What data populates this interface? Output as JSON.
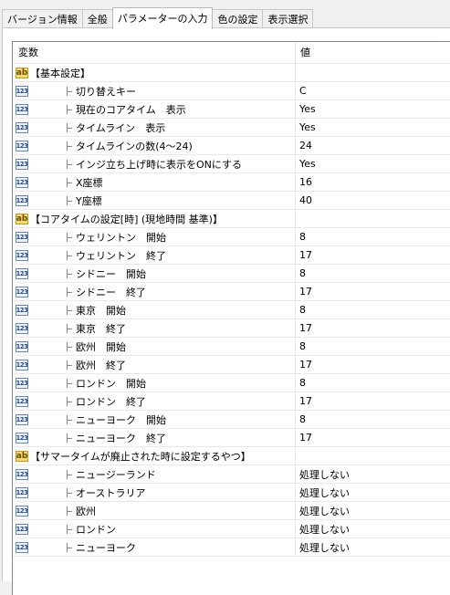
{
  "tabs": [
    "バージョン情報",
    "全般",
    "パラメーターの入力",
    "色の設定",
    "表示選択"
  ],
  "active_tab": 2,
  "columns": {
    "name": "変数",
    "value": "値"
  },
  "rows": [
    {
      "type": "group",
      "label": "【基本設定】",
      "value": ""
    },
    {
      "type": "item",
      "label": "切り替えキー",
      "value": "C"
    },
    {
      "type": "item",
      "label": "現在のコアタイム　表示",
      "value": "Yes"
    },
    {
      "type": "item",
      "label": "タイムライン　表示",
      "value": "Yes"
    },
    {
      "type": "item",
      "label": "タイムラインの数(4〜24)",
      "value": "24"
    },
    {
      "type": "item",
      "label": "インジ立ち上げ時に表示をONにする",
      "value": "Yes"
    },
    {
      "type": "item",
      "label": "X座標",
      "value": "16"
    },
    {
      "type": "item",
      "label": "Y座標",
      "value": "40"
    },
    {
      "type": "group",
      "label": "【コアタイムの設定[時] (現地時間 基準)】",
      "value": ""
    },
    {
      "type": "item",
      "label": "ウェリントン　開始",
      "value": "8"
    },
    {
      "type": "item",
      "label": "ウェリントン　終了",
      "value": "17"
    },
    {
      "type": "item",
      "label": "シドニー　開始",
      "value": "8"
    },
    {
      "type": "item",
      "label": "シドニー　終了",
      "value": "17"
    },
    {
      "type": "item",
      "label": "東京　開始",
      "value": "8"
    },
    {
      "type": "item",
      "label": "東京　終了",
      "value": "17"
    },
    {
      "type": "item",
      "label": "欧州　開始",
      "value": "8"
    },
    {
      "type": "item",
      "label": "欧州　終了",
      "value": "17"
    },
    {
      "type": "item",
      "label": "ロンドン　開始",
      "value": "8"
    },
    {
      "type": "item",
      "label": "ロンドン　終了",
      "value": "17"
    },
    {
      "type": "item",
      "label": "ニューヨーク　開始",
      "value": "8"
    },
    {
      "type": "item",
      "label": "ニューヨーク　終了",
      "value": "17"
    },
    {
      "type": "group",
      "label": "【サマータイムが廃止された時に設定するやつ】",
      "value": ""
    },
    {
      "type": "item",
      "label": "ニュージーランド",
      "value": "処理しない"
    },
    {
      "type": "item",
      "label": "オーストラリア",
      "value": "処理しない"
    },
    {
      "type": "item",
      "label": "欧州",
      "value": "処理しない"
    },
    {
      "type": "item",
      "label": "ロンドン",
      "value": "処理しない"
    },
    {
      "type": "item",
      "label": "ニューヨーク",
      "value": "処理しない"
    }
  ],
  "icons": {
    "group": "ab-string-icon",
    "item": "123-number-icon"
  },
  "colors": {
    "window_bg": "#f0f0f0",
    "panel_bg": "#ffffff",
    "border": "#828790"
  }
}
